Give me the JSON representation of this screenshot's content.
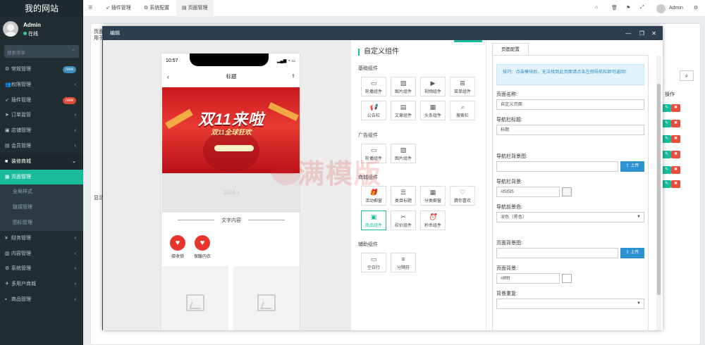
{
  "brand": "我的网站",
  "user": {
    "name": "Admin",
    "status": "在线"
  },
  "sidebar": {
    "search_placeholder": "搜索菜单",
    "items": [
      {
        "label": "常规管理",
        "icon": "gear-icon",
        "badge": "new",
        "badge_color": "#3c8dbc"
      },
      {
        "label": "权限管理",
        "icon": "users-icon"
      },
      {
        "label": "插件管理",
        "icon": "rocket-icon",
        "badge": "new",
        "badge_color": "#dd4b39"
      },
      {
        "label": "订单监管",
        "icon": "send-icon"
      },
      {
        "label": "店铺管理",
        "icon": "shop-icon"
      },
      {
        "label": "会员管理",
        "icon": "member-icon"
      },
      {
        "label": "装修商城",
        "icon": "decorate-icon"
      },
      {
        "label": "页面管理"
      },
      {
        "label": "全局样式"
      },
      {
        "label": "链接管理"
      },
      {
        "label": "图标管理"
      },
      {
        "label": "财务管理",
        "icon": "finance-icon"
      },
      {
        "label": "内容管理",
        "icon": "content-icon"
      },
      {
        "label": "系统管理",
        "icon": "system-icon"
      },
      {
        "label": "多用户商城",
        "icon": "multi-shop-icon"
      },
      {
        "label": "商品管理",
        "icon": "goods-icon"
      }
    ]
  },
  "topbar": {
    "tabs": [
      "插件管理",
      "系统配置",
      "页面管理"
    ],
    "admin": "Admin"
  },
  "panel": {
    "title": "页面",
    "subtitle": "用于",
    "col_op": "操作",
    "footer": "显示"
  },
  "dialog": {
    "title": "编辑",
    "phone": {
      "time": "10:57",
      "nav_title": "标题",
      "banner_big": "双11来啦",
      "banner_small": "双11全球狂欢",
      "placeholder_size": "1024 x",
      "section_title": "文字内容",
      "nav_items": [
        "接收锁",
        "保暖内衣"
      ]
    },
    "components": {
      "title": "自定义组件",
      "groups": [
        {
          "title": "基础组件",
          "items": [
            "轮播组件",
            "图片组件",
            "视频组件",
            "菜单组件",
            "公告栏",
            "文章组件",
            "头条组件",
            "搜索栏"
          ]
        },
        {
          "title": "广告组件",
          "items": [
            "轮播组件",
            "图片组件"
          ]
        },
        {
          "title": "商城组件",
          "items": [
            "活动橱窗",
            "类目标题",
            "分类橱窗",
            "猜你喜欢",
            "商品组件",
            "砍价组件",
            "秒杀组件"
          ]
        },
        {
          "title": "辅助组件",
          "items": [
            "空白行",
            "分隔符"
          ]
        }
      ]
    },
    "config": {
      "tab": "页面配置",
      "tip": "技巧：点击模块后，无法找到此页面请点击左侧导航栏即可返回！",
      "page_name_label": "页面名称:",
      "page_name_value": "自定义页面",
      "nav_title_label": "导航栏标题:",
      "nav_title_value": "标题",
      "nav_bg_img_label": "导航栏背景图:",
      "upload": "上传",
      "nav_bg_label": "导航栏背景:",
      "nav_bg_value": "#f5f5f5",
      "nav_fg_label": "导航前景色:",
      "nav_fg_value": "深色（黑色）",
      "page_bg_img_label": "页面背景图:",
      "page_bg_label": "页面背景:",
      "page_bg_value": "#ffffff",
      "bg_repeat_label": "背景重复:",
      "bg_repeat_value": ""
    }
  },
  "watermark": "一满模版",
  "colors": {
    "accent": "#18bc9c",
    "sidebar": "#222d32",
    "dialog_head": "#2c3e50",
    "upload": "#2d92d0"
  }
}
